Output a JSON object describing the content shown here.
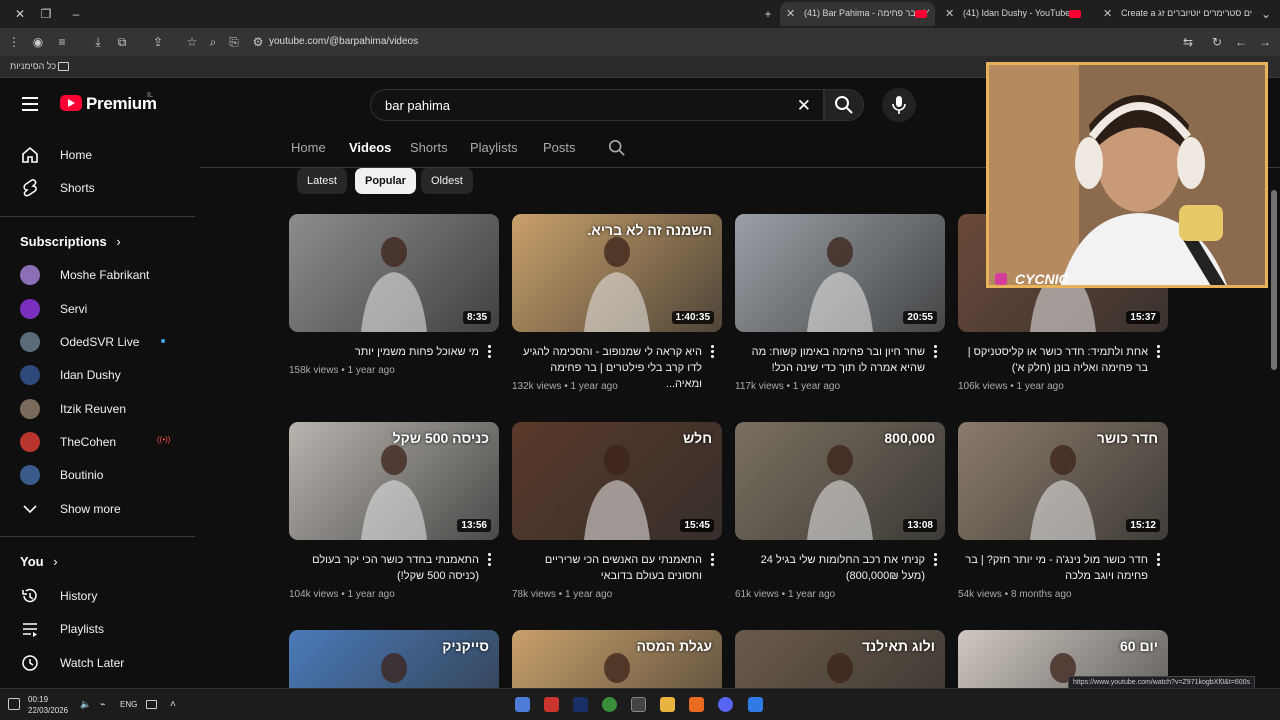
{
  "browser": {
    "tabs": [
      {
        "label": "(41) Bar Pahima - בר פחימה - Y",
        "active": true
      },
      {
        "label": "(41) Idan Dushy - YouTube",
        "active": false
      },
      {
        "label": "Create a טוסטרים סטרימרים יוטיוברים זג",
        "active": false
      }
    ],
    "url": "youtube.com/@barpahima/videos",
    "bookmarks_label": "כל הסימניות"
  },
  "header": {
    "logo_text": "Premium",
    "country": "IL",
    "search_value": "bar pahima"
  },
  "sidebar": {
    "main": [
      {
        "label": "Home",
        "icon": "home-icon"
      },
      {
        "label": "Shorts",
        "icon": "shorts-icon"
      }
    ],
    "subscriptions_title": "Subscriptions",
    "subscriptions": [
      {
        "label": "Moshe Fabrikant",
        "color": "#8a6fb7"
      },
      {
        "label": "Servi",
        "color": "#7b2fbe"
      },
      {
        "label": "OdedSVR Live",
        "color": "#5b6b7a"
      },
      {
        "label": "Idan Dushy",
        "color": "#2f4a7a"
      },
      {
        "label": "Itzik Reuven",
        "color": "#7a6a5c"
      },
      {
        "label": "TheCohen",
        "color": "#b8342f"
      },
      {
        "label": "Boutinio",
        "color": "#3a5a8a"
      }
    ],
    "show_more": "Show more",
    "you_title": "You",
    "you": [
      {
        "label": "History",
        "icon": "history-icon"
      },
      {
        "label": "Playlists",
        "icon": "playlists-icon"
      },
      {
        "label": "Watch Later",
        "icon": "watch-later-icon"
      }
    ]
  },
  "channel_tabs": [
    "Home",
    "Videos",
    "Shorts",
    "Playlists",
    "Posts"
  ],
  "active_tab": "Videos",
  "chips": [
    "Latest",
    "Popular",
    "Oldest"
  ],
  "active_chip": "Popular",
  "videos": [
    {
      "title": "מי שאוכל פחות משמין יותר",
      "views": "158k views",
      "age": "1 year ago",
      "duration": "8:35",
      "bg": "#8d8d8d",
      "thumb_text": ""
    },
    {
      "title": "היא קראה לי שמנופוב - והסכימה להגיע לדו קרב בלי פילטרים | בר פחימה ומאיה...",
      "views": "132k views",
      "age": "1 year ago",
      "duration": "1:40:35",
      "bg": "#c9a06a",
      "thumb_text": "השמנה זה לא בריא."
    },
    {
      "title": "שחר חיון ובר פחימה באימון קשוח: מה שהיא אמרה לו תוך כדי שינה הכל!",
      "views": "117k views",
      "age": "1 year ago",
      "duration": "20:55",
      "bg": "#9aa0a6",
      "thumb_text": ""
    },
    {
      "title": "אחת ולתמיד: חדר כושר או קליסטניקס | בר פחימה ואליה בונן (חלק א')",
      "views": "106k views",
      "age": "1 year ago",
      "duration": "15:37",
      "bg": "#6b4a3a",
      "thumb_text": ""
    },
    {
      "title": "התאמנתי בחדר כושר הכי יקר בעולם (כניסה 500 שקל!)",
      "views": "104k views",
      "age": "1 year ago",
      "duration": "13:56",
      "bg": "#b8b4ae",
      "thumb_text": "כניסה 500 שקל"
    },
    {
      "title": "התאמנתי עם האנשים הכי שריריים וחסונים בעולם בדובאי",
      "views": "78k views",
      "age": "1 year ago",
      "duration": "15:45",
      "bg": "#5a3a2a",
      "thumb_text": "חלש"
    },
    {
      "title": "קניתי את רכב החלומות שלי בגיל 24 (מעל 800,000₪)",
      "views": "61k views",
      "age": "1 year ago",
      "duration": "13:08",
      "bg": "#7a7060",
      "thumb_text": "800,000"
    },
    {
      "title": "חדר כושר מול נינג'ה - מי יותר חזק? | בר פחימה ויוגב מלכה",
      "views": "54k views",
      "age": "8 months ago",
      "duration": "15:12",
      "bg": "#8a7b6a",
      "thumb_text": "חדר כושר"
    },
    {
      "title": "",
      "views": "",
      "age": "",
      "duration": "",
      "bg": "#4a7ab8",
      "thumb_text": "סייקניק"
    },
    {
      "title": "",
      "views": "",
      "age": "",
      "duration": "",
      "bg": "#c9a06a",
      "thumb_text": "עגלת המסה"
    },
    {
      "title": "",
      "views": "",
      "age": "",
      "duration": "",
      "bg": "#6a5a4a",
      "thumb_text": "ולוג תאילנד"
    },
    {
      "title": "",
      "views": "",
      "age": "",
      "duration": "",
      "bg": "#cfc8c0",
      "thumb_text": "יום 60"
    }
  ],
  "webcam_name": "CYCNIC",
  "status_url": "https://www.youtube.com/watch?v=Z971kogbXf0&t=600s",
  "taskbar": {
    "time": "00:19",
    "date": "22/03/2026",
    "lang": "ENG"
  }
}
